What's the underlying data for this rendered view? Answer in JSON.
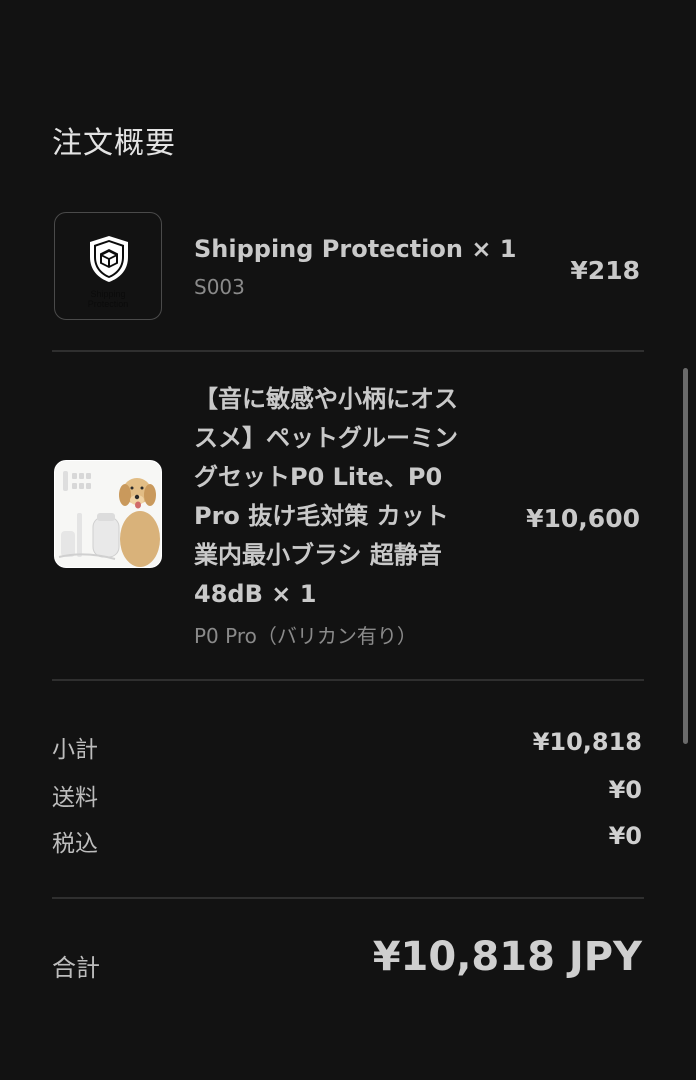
{
  "page_title": "注文概要",
  "items": [
    {
      "name": "Shipping Protection × 1",
      "sku": "S003",
      "price": "¥218",
      "thumb_label_line1": "Shipping",
      "thumb_label_line2": "Protection",
      "icon": "shield-box-icon"
    },
    {
      "name_lines": [
        "【音に敏感や小柄にオス",
        "スメ】ペットグルーミン",
        "グセットP0 Lite、P0",
        "Pro 抜け毛対策 カット",
        "業内最小ブラシ 超静音",
        "48dB × 1"
      ],
      "variant": "P0 Pro（バリカン有り）",
      "price": "¥10,600"
    }
  ],
  "summary": {
    "subtotal_label": "小計",
    "subtotal_value": "¥10,818",
    "shipping_label": "送料",
    "shipping_value": "¥0",
    "tax_label": "税込",
    "tax_value": "¥0"
  },
  "total": {
    "label": "合計",
    "value": "¥10,818 JPY"
  },
  "colors": {
    "background": "#121212",
    "text": "#c9c9c9",
    "muted": "#8a8a8a",
    "divider": "#2f2f2f"
  }
}
